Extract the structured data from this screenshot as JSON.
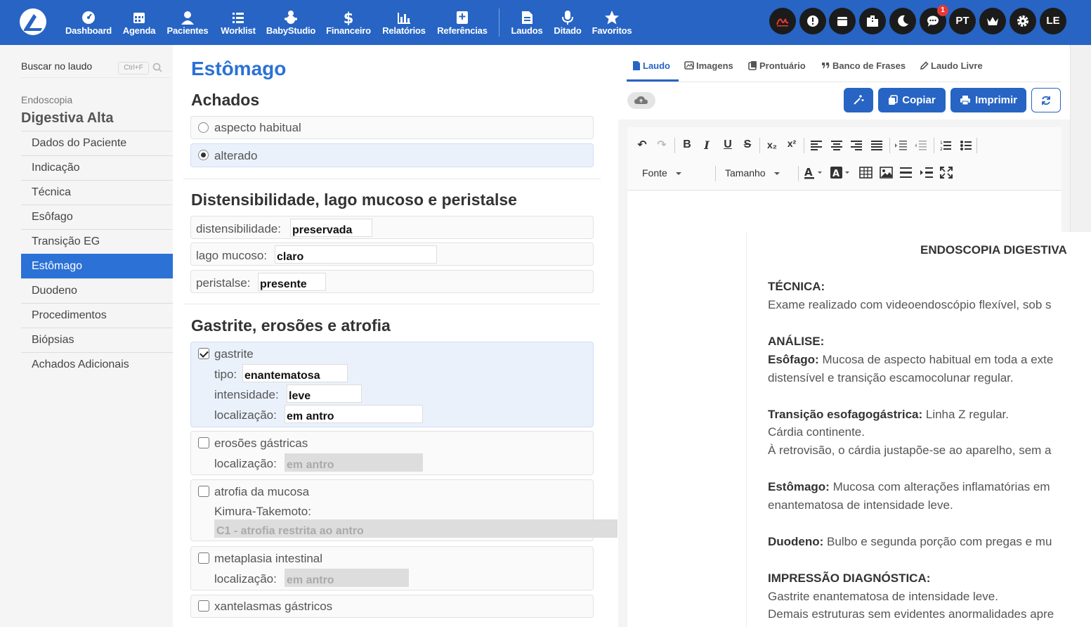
{
  "nav": {
    "items": [
      {
        "label": "Dashboard",
        "icon": "dashboard-icon"
      },
      {
        "label": "Agenda",
        "icon": "calendar-icon"
      },
      {
        "label": "Pacientes",
        "icon": "user-icon"
      },
      {
        "label": "Worklist",
        "icon": "list-icon"
      },
      {
        "label": "BabyStudio",
        "icon": "baby-icon"
      },
      {
        "label": "Financeiro",
        "icon": "dollar-icon"
      },
      {
        "label": "Relatórios",
        "icon": "chart-icon"
      },
      {
        "label": "Referências",
        "icon": "plus-book-icon"
      },
      {
        "label": "Laudos",
        "icon": "document-icon"
      },
      {
        "label": "Ditado",
        "icon": "microphone-icon"
      },
      {
        "label": "Favoritos",
        "icon": "star-icon"
      }
    ],
    "notification_count": "1",
    "language": "PT",
    "user_initials": "LE"
  },
  "sidebar": {
    "search_label": "Buscar no laudo",
    "search_shortcut": "Ctrl+F",
    "section": "Endoscopia",
    "title": "Digestiva Alta",
    "items": [
      "Dados do Paciente",
      "Indicação",
      "Técnica",
      "Esôfago",
      "Transição EG",
      "Estômago",
      "Duodeno",
      "Procedimentos",
      "Biópsias",
      "Achados Adicionais"
    ],
    "active_item": "Estômago"
  },
  "form": {
    "title": "Estômago",
    "achados": {
      "heading": "Achados",
      "opt1": "aspecto habitual",
      "opt2": "alterado",
      "selected": "alterado"
    },
    "dist": {
      "heading": "Distensibilidade, lago mucoso e peristalse",
      "f1_label": "distensibilidade:",
      "f1_value": "preservada",
      "f2_label": "lago mucoso:",
      "f2_value": "claro",
      "f3_label": "peristalse:",
      "f3_value": "presente"
    },
    "gastrite": {
      "heading": "Gastrite, erosões e atrofia",
      "g_label": "gastrite",
      "g_checked": true,
      "tipo_label": "tipo:",
      "tipo_value": "enantematosa",
      "int_label": "intensidade:",
      "int_value": "leve",
      "loc_label": "localização:",
      "loc_value": "em antro",
      "ero_label": "erosões gástricas",
      "ero_loc_label": "localização:",
      "ero_loc_value": "em antro",
      "atr_label": "atrofia da mucosa",
      "atr_kimura_label": "Kimura-Takemoto:",
      "atr_kimura_value": "C1 - atrofia restrita ao antro",
      "met_label": "metaplasia intestinal",
      "met_loc_label": "localização:",
      "met_loc_value": "em antro",
      "xan_label": "xantelasmas gástricos"
    }
  },
  "right": {
    "tabs": [
      "Laudo",
      "Imagens",
      "Prontuário",
      "Banco de Frases",
      "Laudo Livre"
    ],
    "active_tab": "Laudo",
    "copy_label": "Copiar",
    "print_label": "Imprimir",
    "font_label": "Fonte",
    "size_label": "Tamanho",
    "report": {
      "title": "ENDOSCOPIA DIGESTIVA",
      "tec_h": "TÉCNICA:",
      "tec_t": "Exame realizado com videoendoscópio flexível, sob s",
      "ana_h": "ANÁLISE:",
      "eso_h": "Esôfago:",
      "eso_t": " Mucosa de aspecto habitual em toda a exte",
      "eso_t2": "distensível e transição escamocolunar regular.",
      "tra_h": "Transição esofagogástrica:",
      "tra_t": " Linha Z regular.",
      "tra_t2": "Cárdia continente.",
      "tra_t3": "À retrovisão, o cárdia justapõe-se ao aparelho, sem a",
      "est_h": "Estômago:",
      "est_t": " Mucosa com alterações inflamatórias em",
      "est_t2": "enantematosa de intensidade leve.",
      "duo_h": "Duodeno:",
      "duo_t": " Bulbo e segunda porção com pregas e mu",
      "imp_h": "IMPRESSÃO DIAGNÓSTICA:",
      "imp_t": "Gastrite enantematosa de intensidade leve.",
      "imp_t2": "Demais estruturas sem evidentes anormalidades apre"
    }
  }
}
